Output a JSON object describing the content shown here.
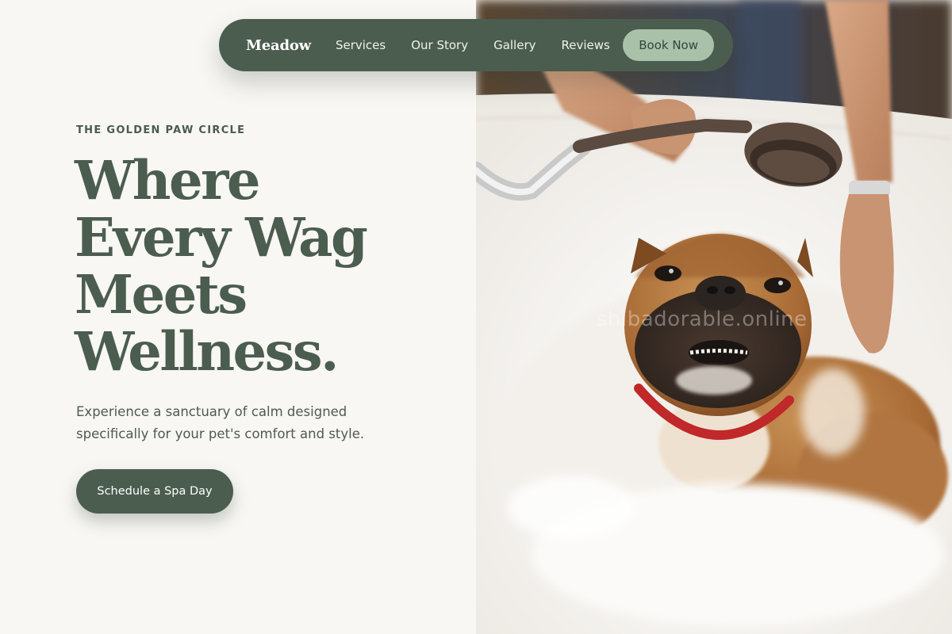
{
  "nav": {
    "logo": "Meadow",
    "links": [
      "Services",
      "Our Story",
      "Gallery",
      "Reviews"
    ],
    "cta": "Book Now"
  },
  "hero": {
    "eyebrow": "THE GOLDEN PAW CIRCLE",
    "headline_lines": [
      "Where",
      "Every Wag",
      "Meets",
      "Wellness."
    ],
    "subtext": "Experience a sanctuary of calm designed specifically for your pet's comfort and style.",
    "cta": "Schedule a Spa Day"
  },
  "photo": {
    "watermark": "shibadorable.online"
  },
  "colors": {
    "primary": "#4b5d4f",
    "accent": "#a9c1a9",
    "background": "#f8f7f4"
  }
}
